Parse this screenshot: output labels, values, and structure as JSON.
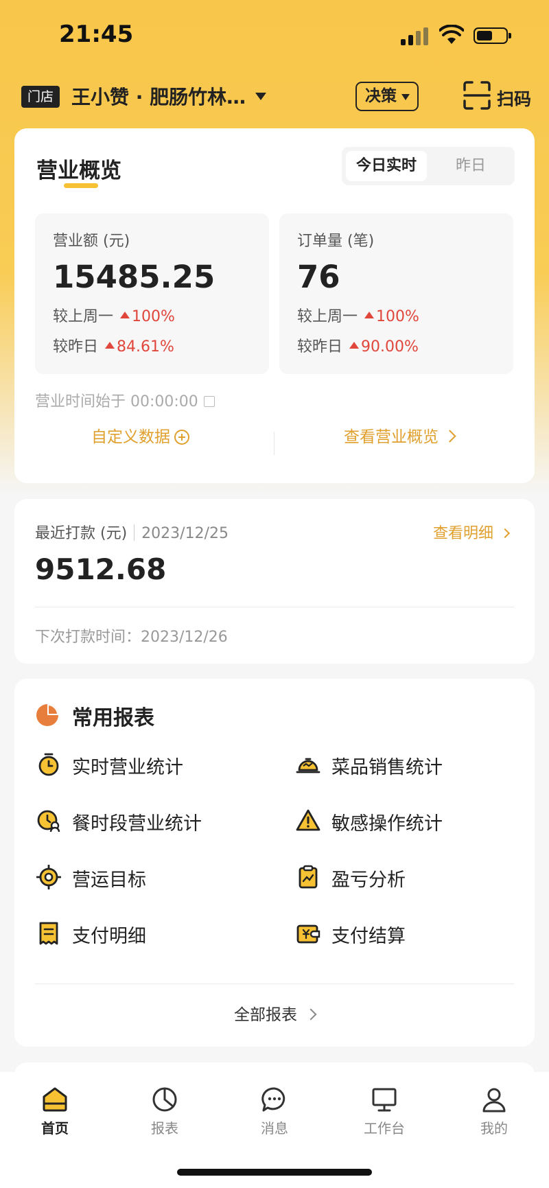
{
  "status_bar": {
    "time": "21:45"
  },
  "header": {
    "store_tag": "门店",
    "store_name": "王小赞 · 肥肠竹林…",
    "decision_label": "决策",
    "scan_label": "扫码"
  },
  "overview": {
    "title": "营业概览",
    "tabs": {
      "active": "今日实时",
      "inactive": "昨日"
    },
    "revenue": {
      "label": "营业额 (元)",
      "value": "15485.25",
      "week_label": "较上周一",
      "week_change": "100%",
      "day_label": "较昨日",
      "day_change": "84.61%"
    },
    "orders": {
      "label": "订单量 (笔)",
      "value": "76",
      "week_label": "较上周一",
      "week_change": "100%",
      "day_label": "较昨日",
      "day_change": "90.00%"
    },
    "business_time": "营业时间始于 00:00:00",
    "custom_data": "自定义数据",
    "view_overview": "查看营业概览"
  },
  "payout": {
    "label": "最近打款 (元)",
    "date": "2023/12/25",
    "detail_link": "查看明细",
    "amount": "9512.68",
    "next": "下次打款时间：2023/12/26"
  },
  "reports": {
    "title": "常用报表",
    "items": [
      {
        "label": "实时营业统计",
        "icon": "stopwatch-icon"
      },
      {
        "label": "菜品销售统计",
        "icon": "cloche-icon"
      },
      {
        "label": "餐时段营业统计",
        "icon": "clock-user-icon"
      },
      {
        "label": "敏感操作统计",
        "icon": "warning-icon"
      },
      {
        "label": "营运目标",
        "icon": "target-icon"
      },
      {
        "label": "盈亏分析",
        "icon": "clipboard-chart-icon"
      },
      {
        "label": "支付明细",
        "icon": "receipt-icon"
      },
      {
        "label": "支付结算",
        "icon": "wallet-yen-icon"
      }
    ],
    "all_link": "全部报表"
  },
  "tabbar": {
    "items": [
      {
        "label": "首页",
        "icon": "home-icon",
        "active": true
      },
      {
        "label": "报表",
        "icon": "pie-chart-icon",
        "active": false
      },
      {
        "label": "消息",
        "icon": "chat-bubble-icon",
        "active": false
      },
      {
        "label": "工作台",
        "icon": "monitor-icon",
        "active": false
      },
      {
        "label": "我的",
        "icon": "user-icon",
        "active": false
      }
    ]
  },
  "colors": {
    "accent": "#F6C133",
    "link": "#E0A02E",
    "increase": "#E0463B",
    "report_icon": "#E87E3C"
  }
}
